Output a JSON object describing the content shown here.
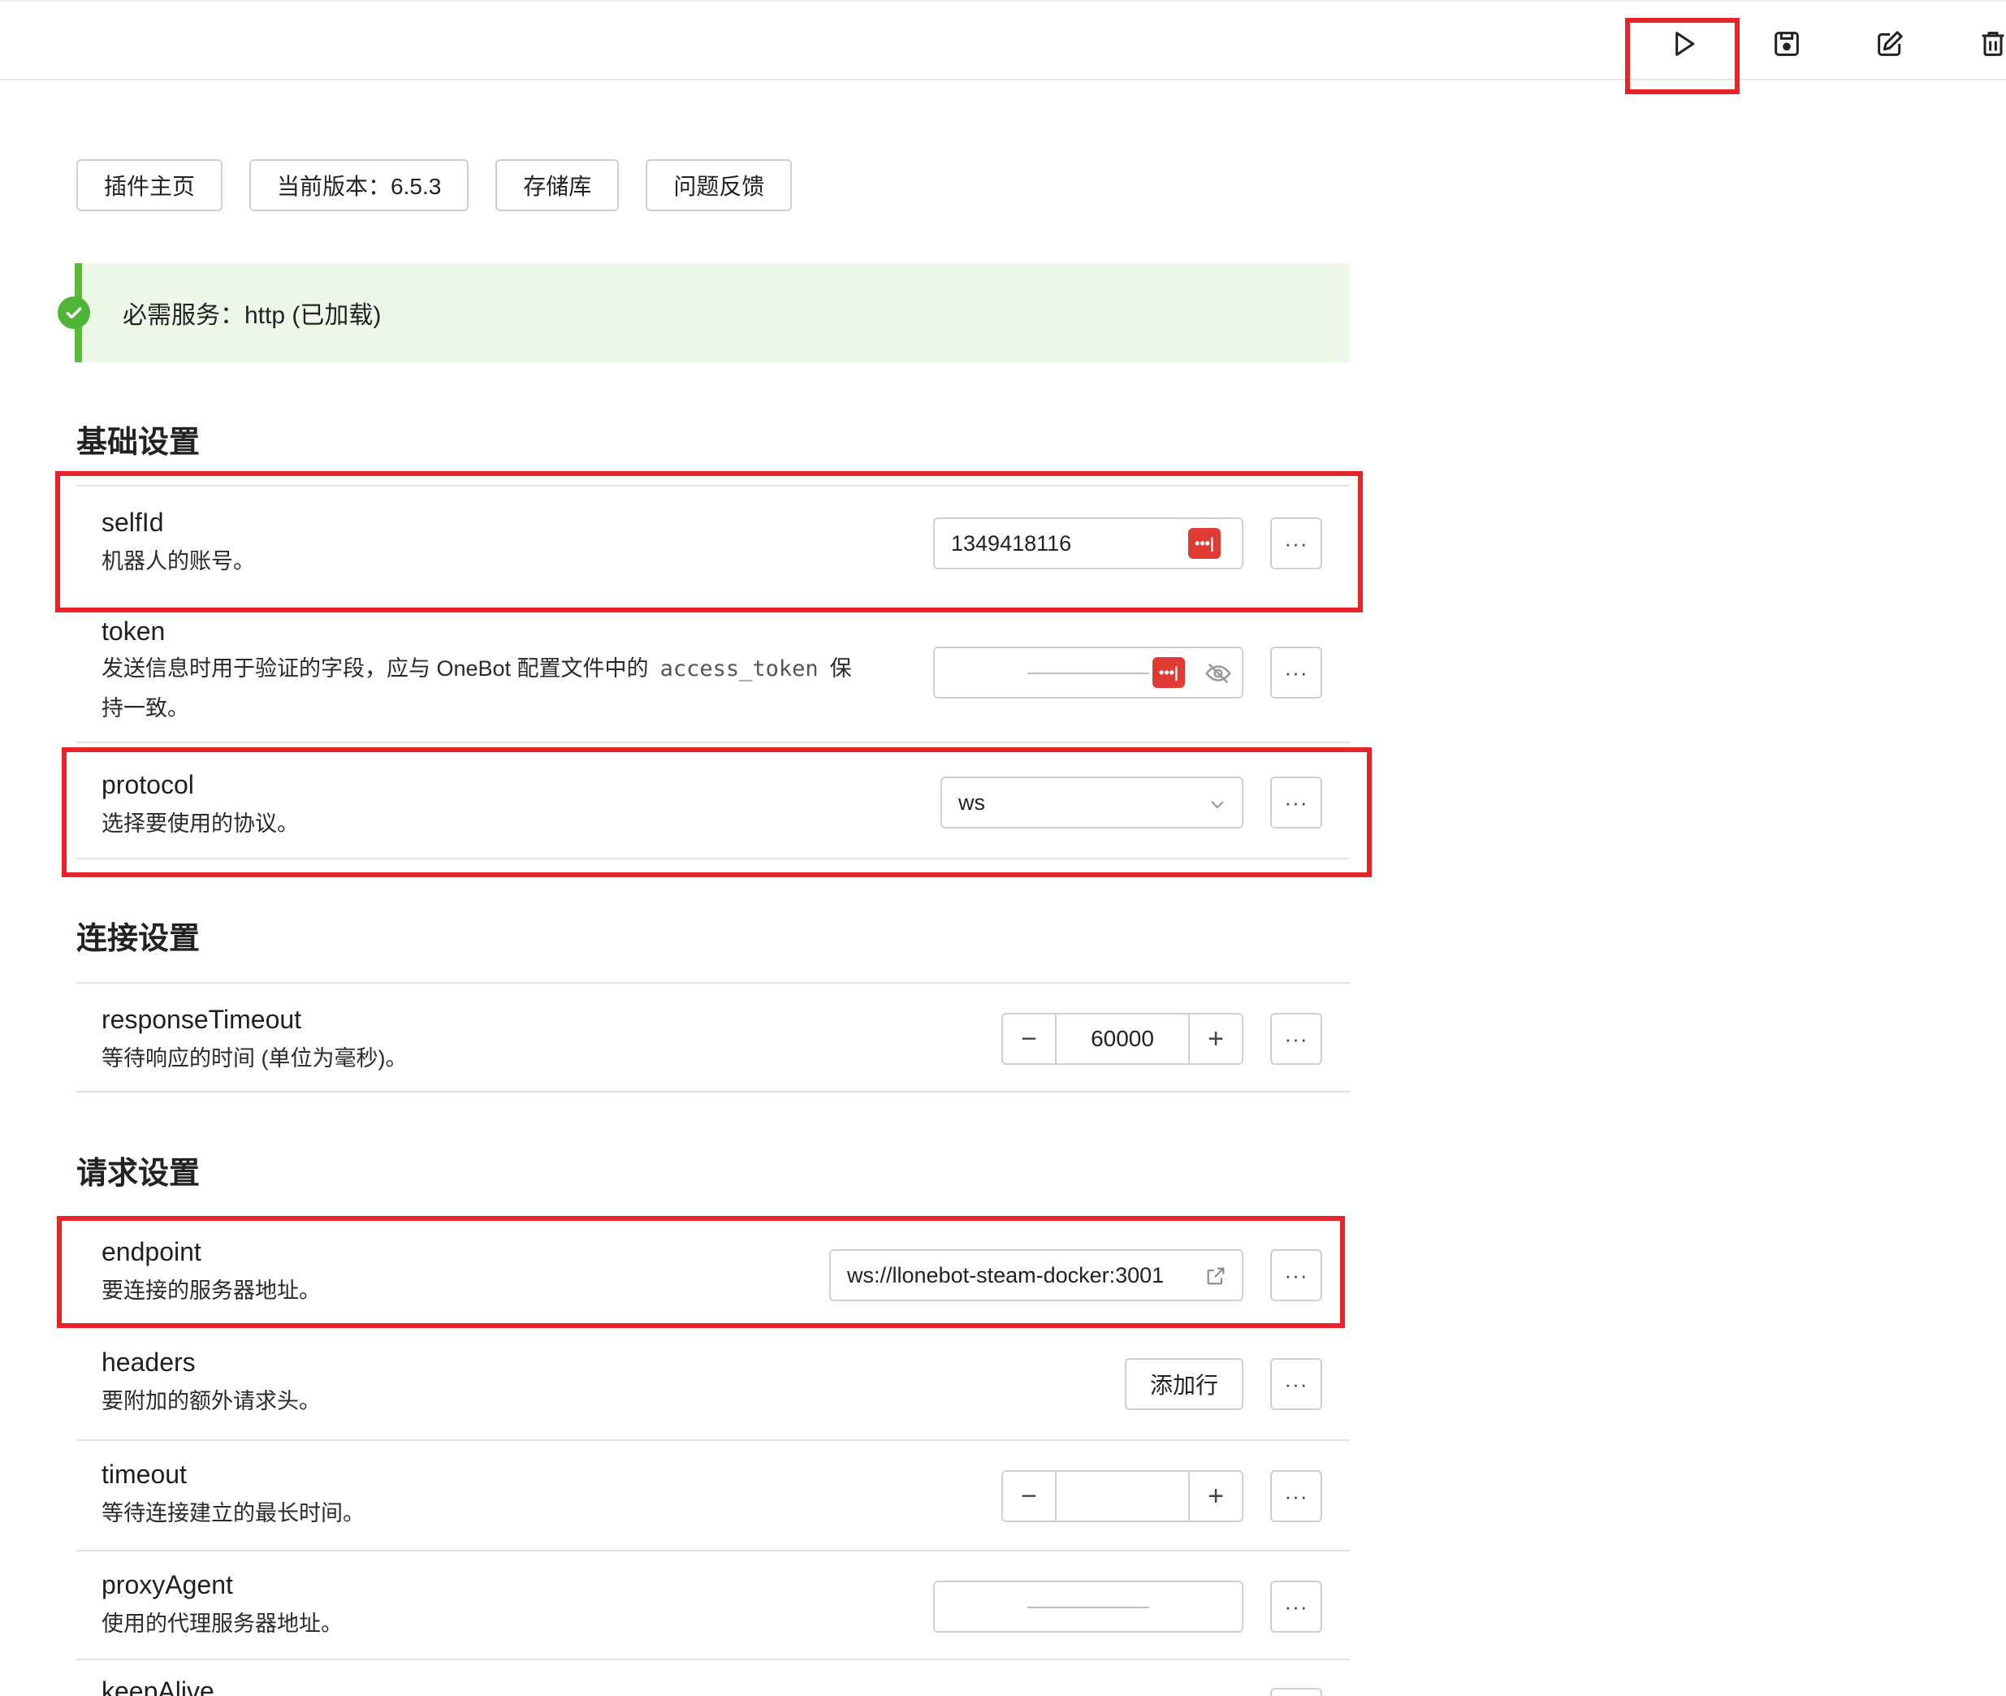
{
  "toolbar": {
    "run_icon": "play-icon",
    "save_icon": "save-icon",
    "edit_icon": "edit-icon",
    "delete_icon": "trash-icon"
  },
  "links": [
    {
      "label": "插件主页"
    },
    {
      "label": "当前版本：6.5.3"
    },
    {
      "label": "存储库"
    },
    {
      "label": "问题反馈"
    }
  ],
  "notice": {
    "text": "必需服务：http (已加载)",
    "color": "#5bb83b"
  },
  "sections": {
    "basic": "基础设置",
    "connection": "连接设置",
    "request": "请求设置"
  },
  "fields": {
    "selfId": {
      "name": "selfId",
      "desc": "机器人的账号。",
      "value": "1349418116"
    },
    "token": {
      "name": "token",
      "desc_a": "发送信息时用于验证的字段，应与 OneBot 配置文件中的",
      "desc_code": "access_token",
      "desc_b": "保",
      "desc_c": "持一致。",
      "value": ""
    },
    "protocol": {
      "name": "protocol",
      "desc": "选择要使用的协议。",
      "value": "ws"
    },
    "responseTimeout": {
      "name": "responseTimeout",
      "desc": "等待响应的时间 (单位为毫秒)。",
      "value": "60000"
    },
    "endpoint": {
      "name": "endpoint",
      "desc": "要连接的服务器地址。",
      "value": "ws://llonebot-steam-docker:3001"
    },
    "headers": {
      "name": "headers",
      "desc": "要附加的额外请求头。",
      "add_label": "添加行"
    },
    "timeout": {
      "name": "timeout",
      "desc": "等待连接建立的最长时间。",
      "value": ""
    },
    "proxyAgent": {
      "name": "proxyAgent",
      "desc": "使用的代理服务器地址。",
      "value": ""
    },
    "keepAlive": {
      "name": "keepAlive"
    }
  },
  "more_label": "···",
  "minus_label": "−",
  "plus_label": "+",
  "accent_red": "#e8232a"
}
